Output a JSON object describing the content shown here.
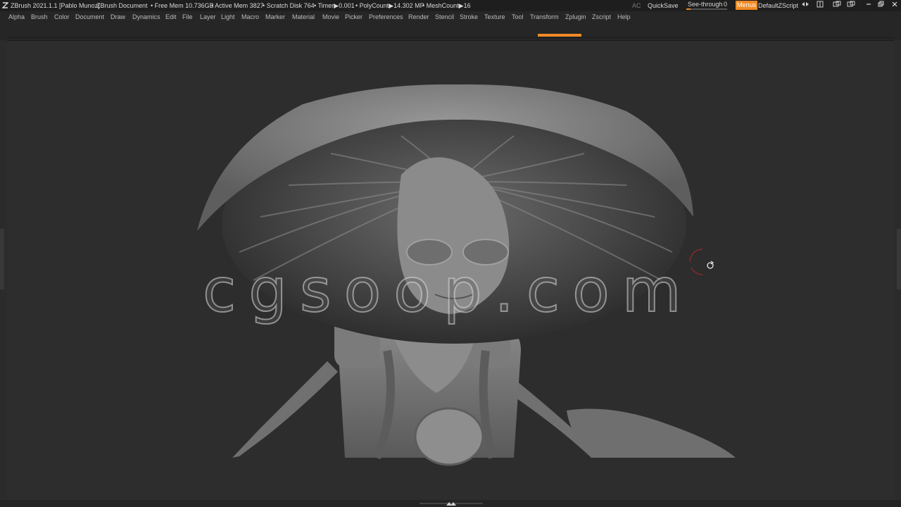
{
  "titlebar": {
    "app": "ZBrush 2021.1.1 [Pablo Munoz]",
    "document": "ZBrush Document",
    "free_mem": "• Free Mem 10.736GB",
    "active_mem": "• Active Mem 3827",
    "scratch": "• Scratch Disk 764",
    "timer": "• Timer▶0.001",
    "polycount": "• PolyCount▶14.302 MP",
    "meshcount": "• MeshCount▶16",
    "ac": "AC",
    "quicksave": "QuickSave",
    "see_through_label": "See-through",
    "see_through_value": "0",
    "menus": "Menus",
    "script": "DefaultZScript"
  },
  "menu": [
    "Alpha",
    "Brush",
    "Color",
    "Document",
    "Draw",
    "Dynamics",
    "Edit",
    "File",
    "Layer",
    "Light",
    "Macro",
    "Marker",
    "Material",
    "Movie",
    "Picker",
    "Preferences",
    "Render",
    "Stencil",
    "Stroke",
    "Texture",
    "Tool",
    "Transform",
    "Zplugin",
    "Zscript",
    "Help"
  ],
  "watermark": "cgsoop.com",
  "colors": {
    "accent": "#f08a24",
    "background": "#2d2d2d"
  },
  "see_through_level": 0
}
